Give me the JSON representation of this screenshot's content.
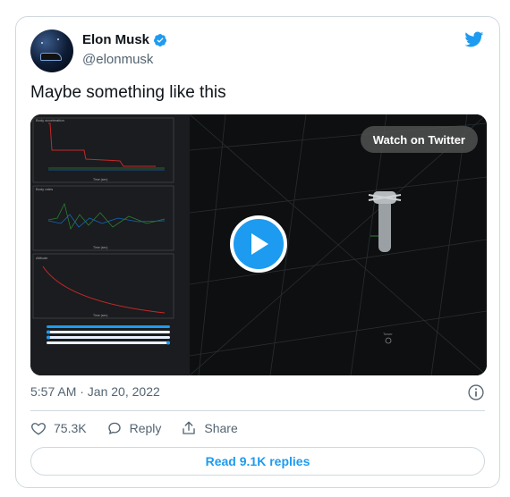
{
  "author": {
    "name": "Elon Musk",
    "handle": "@elonmusk",
    "verified": true
  },
  "tweet": {
    "text": "Maybe something like this"
  },
  "media": {
    "watch_label": "Watch on Twitter",
    "chart_titles": [
      "Body acceleration",
      "Body rates",
      "Altitude"
    ],
    "axis_label": "Time (sec)",
    "hud_label": "Tower"
  },
  "meta": {
    "timestamp": "5:57 AM · Jan 20, 2022"
  },
  "actions": {
    "likes": "75.3K",
    "reply_label": "Reply",
    "share_label": "Share"
  },
  "replies_button": "Read 9.1K replies",
  "colors": {
    "accent": "#1d9bf0",
    "text": "#0f1419",
    "muted": "#536471",
    "border": "#cfd9de"
  }
}
